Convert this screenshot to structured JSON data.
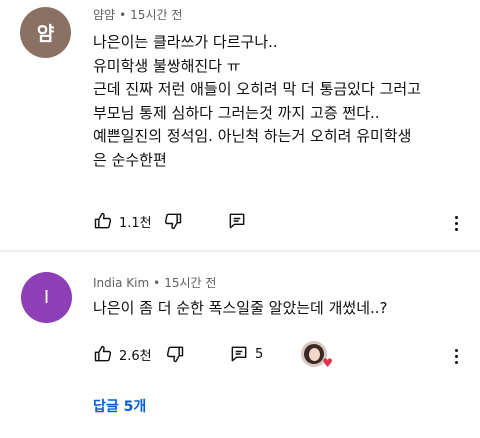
{
  "comments": [
    {
      "avatar_initial": "얌",
      "avatar_color": "#8a7163",
      "author": "얌얌",
      "time": "15시간 전",
      "lines": [
        "나은이는 클라쓰가 다르구나..",
        "유미학생 불쌍해진다 ㅠ",
        "근데 진짜 저런 애들이 오히려 막 더 통금있다 그러고",
        "부모님 통제 심하다 그러는것 까지 고증 쩐다..",
        "예쁜일진의 정석임. 아닌척 하는거 오히려 유미학생",
        "은 순수한편"
      ],
      "likes": "1.1천",
      "icons": {
        "like": "thumbs-up-icon",
        "dislike": "thumbs-down-icon",
        "reply": "reply-icon",
        "more": "more-vertical-icon"
      }
    },
    {
      "avatar_initial": "I",
      "avatar_color": "#8e3fb5",
      "author": "India Kim",
      "time": "15시간 전",
      "lines": [
        "나은이 좀 더 순한 폭스일줄 알았는데 개썼네..?"
      ],
      "likes": "2.6천",
      "replies_count": "5",
      "replies_link": "답글 5개",
      "heart_color": "#e0314b",
      "icons": {
        "like": "thumbs-up-icon",
        "dislike": "thumbs-down-icon",
        "reply": "reply-icon",
        "more": "more-vertical-icon"
      }
    }
  ],
  "separator": "•"
}
